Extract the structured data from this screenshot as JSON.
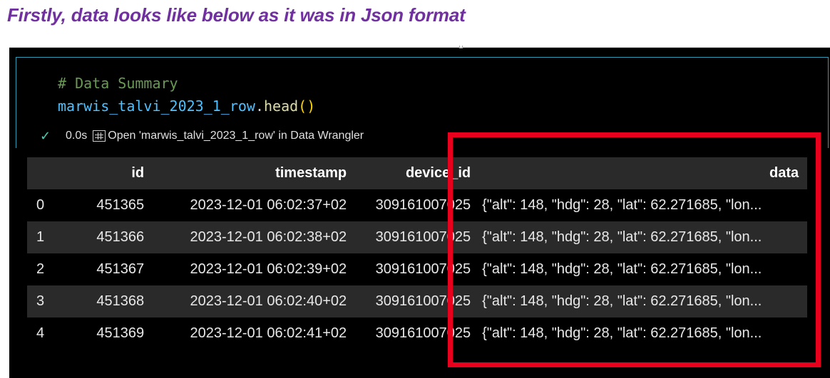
{
  "heading": "Firstly, data looks like below as it was in Json format",
  "cell": {
    "comment": "# Data Summary",
    "code_var": "marwis_talvi_2023_1_row",
    "code_dot": ".",
    "code_fn": "head",
    "code_paren": "()"
  },
  "status": {
    "check_icon": "✓",
    "time": "0.0s",
    "wrangler_label": "Open 'marwis_talvi_2023_1_row' in Data Wrangler"
  },
  "table": {
    "columns": [
      "",
      "id",
      "timestamp",
      "device_id",
      "data"
    ],
    "rows": [
      {
        "index": "0",
        "id": "451365",
        "timestamp": "2023-12-01 06:02:37+02",
        "device_id": "309161007025",
        "data": "{\"alt\": 148, \"hdg\": 28, \"lat\": 62.271685, \"lon..."
      },
      {
        "index": "1",
        "id": "451366",
        "timestamp": "2023-12-01 06:02:38+02",
        "device_id": "309161007025",
        "data": "{\"alt\": 148, \"hdg\": 28, \"lat\": 62.271685, \"lon..."
      },
      {
        "index": "2",
        "id": "451367",
        "timestamp": "2023-12-01 06:02:39+02",
        "device_id": "309161007025",
        "data": "{\"alt\": 148, \"hdg\": 28, \"lat\": 62.271685, \"lon..."
      },
      {
        "index": "3",
        "id": "451368",
        "timestamp": "2023-12-01 06:02:40+02",
        "device_id": "309161007025",
        "data": "{\"alt\": 148, \"hdg\": 28, \"lat\": 62.271685, \"lon..."
      },
      {
        "index": "4",
        "id": "451369",
        "timestamp": "2023-12-01 06:02:41+02",
        "device_id": "309161007025",
        "data": "{\"alt\": 148, \"hdg\": 28, \"lat\": 62.271685, \"lon..."
      }
    ]
  },
  "colors": {
    "heading": "#7030a0",
    "highlight": "#e8001c",
    "cell_border": "#2f9cb5"
  },
  "icons": {
    "check": "check-icon",
    "wrangler": "data-wrangler-icon"
  }
}
